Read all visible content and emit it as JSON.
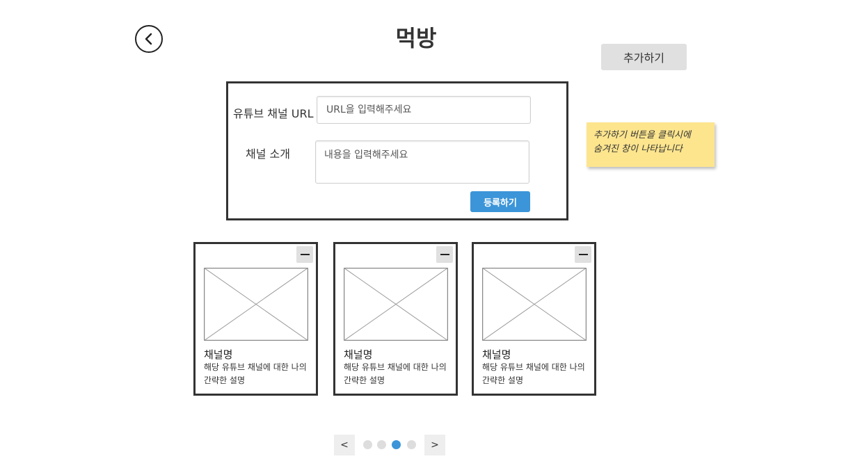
{
  "header": {
    "title": "먹방",
    "add_label": "추가하기"
  },
  "form": {
    "url_label": "유튜브 채널 URL",
    "url_placeholder": "URL을 입력해주세요",
    "desc_label": "채널 소개",
    "desc_placeholder": "내용을 입력해주세요",
    "submit_label": "등록하기"
  },
  "note": {
    "line1": "추가하기 버튼을 클릭시에",
    "line2": "숨겨진 창이 나타납니다"
  },
  "cards": [
    {
      "title": "채널명",
      "description": "해당 유튜브 채널에 대한 나의 간략한 설명"
    },
    {
      "title": "채널명",
      "description": "해당 유튜브 채널에 대한 나의 간략한 설명"
    },
    {
      "title": "채널명",
      "description": "해당 유튜브 채널에 대한 나의 간략한 설명"
    }
  ],
  "pagination": {
    "prev_label": "<",
    "next_label": ">",
    "page_count": 4,
    "active_page": 3
  },
  "icons": {
    "back": "chevron-left-circle-icon",
    "remove": "minus-icon",
    "thumbnail": "image-placeholder-icon"
  },
  "colors": {
    "accent": "#3b95d8",
    "note": "#fde58e",
    "button_gray": "#e0e0e0"
  }
}
